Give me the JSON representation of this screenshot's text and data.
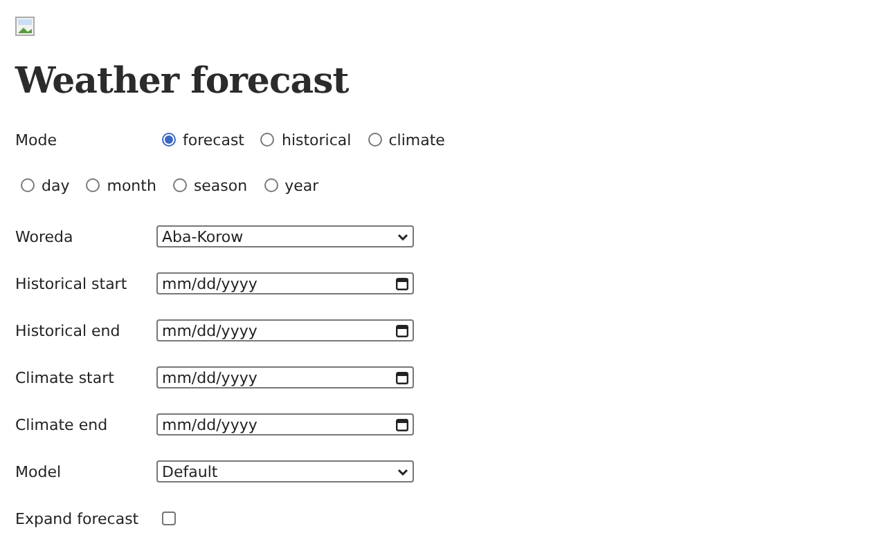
{
  "title": "Weather forecast",
  "mode": {
    "label": "Mode",
    "options": [
      {
        "label": "forecast",
        "selected": true
      },
      {
        "label": "historical",
        "selected": false
      },
      {
        "label": "climate",
        "selected": false
      }
    ]
  },
  "period": {
    "options": [
      {
        "label": "day",
        "selected": false
      },
      {
        "label": "month",
        "selected": false
      },
      {
        "label": "season",
        "selected": false
      },
      {
        "label": "year",
        "selected": false
      }
    ]
  },
  "fields": [
    {
      "kind": "select",
      "label": "Woreda",
      "value": "Aba-Korow"
    },
    {
      "kind": "date",
      "label": "Historical start",
      "placeholder": "mm/dd/yyyy"
    },
    {
      "kind": "date",
      "label": "Historical end",
      "placeholder": "mm/dd/yyyy"
    },
    {
      "kind": "date",
      "label": "Climate start",
      "placeholder": "mm/dd/yyyy"
    },
    {
      "kind": "date",
      "label": "Climate end",
      "placeholder": "mm/dd/yyyy"
    },
    {
      "kind": "select",
      "label": "Model",
      "value": "Default"
    },
    {
      "kind": "checkbox",
      "label": "Expand forecast",
      "checked": false
    }
  ]
}
